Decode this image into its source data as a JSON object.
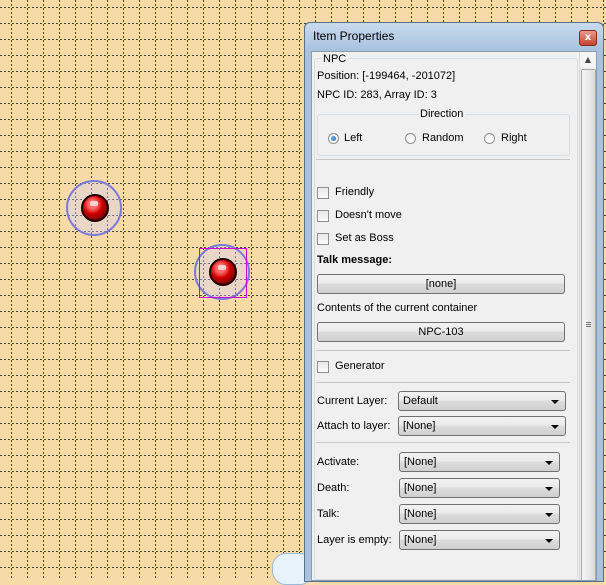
{
  "window": {
    "title": "Item Properties",
    "close_glyph": "x"
  },
  "panel": {
    "group_label": "NPC",
    "position_text": "Position: [-199464, -201072]",
    "id_text": "NPC ID: 283, Array ID: 3",
    "direction": {
      "label": "Direction",
      "options": [
        "Left",
        "Random",
        "Right"
      ],
      "selected": "Left"
    },
    "checkboxes": {
      "friendly": "Friendly",
      "doesnt_move": "Doesn't move",
      "set_as_boss": "Set as Boss",
      "generator": "Generator"
    },
    "talk_message": {
      "label": "Talk message:",
      "value": "[none]"
    },
    "contents": {
      "label": "Contents of the current container",
      "value": "NPC-103"
    },
    "layers": {
      "current_layer_label": "Current Layer:",
      "current_layer_value": "Default",
      "attach_label": "Attach to layer:",
      "attach_value": "[None]"
    },
    "events": {
      "activate_label": "Activate:",
      "activate_value": "[None]",
      "death_label": "Death:",
      "death_value": "[None]",
      "talk_label": "Talk:",
      "talk_value": "[None]",
      "layer_empty_label": "Layer is empty:",
      "layer_empty_value": "[None]"
    }
  },
  "colors": {
    "canvas_bg": "#f8d9a8",
    "selection": "#d000d0",
    "npc_ring": "#7a7adb"
  }
}
